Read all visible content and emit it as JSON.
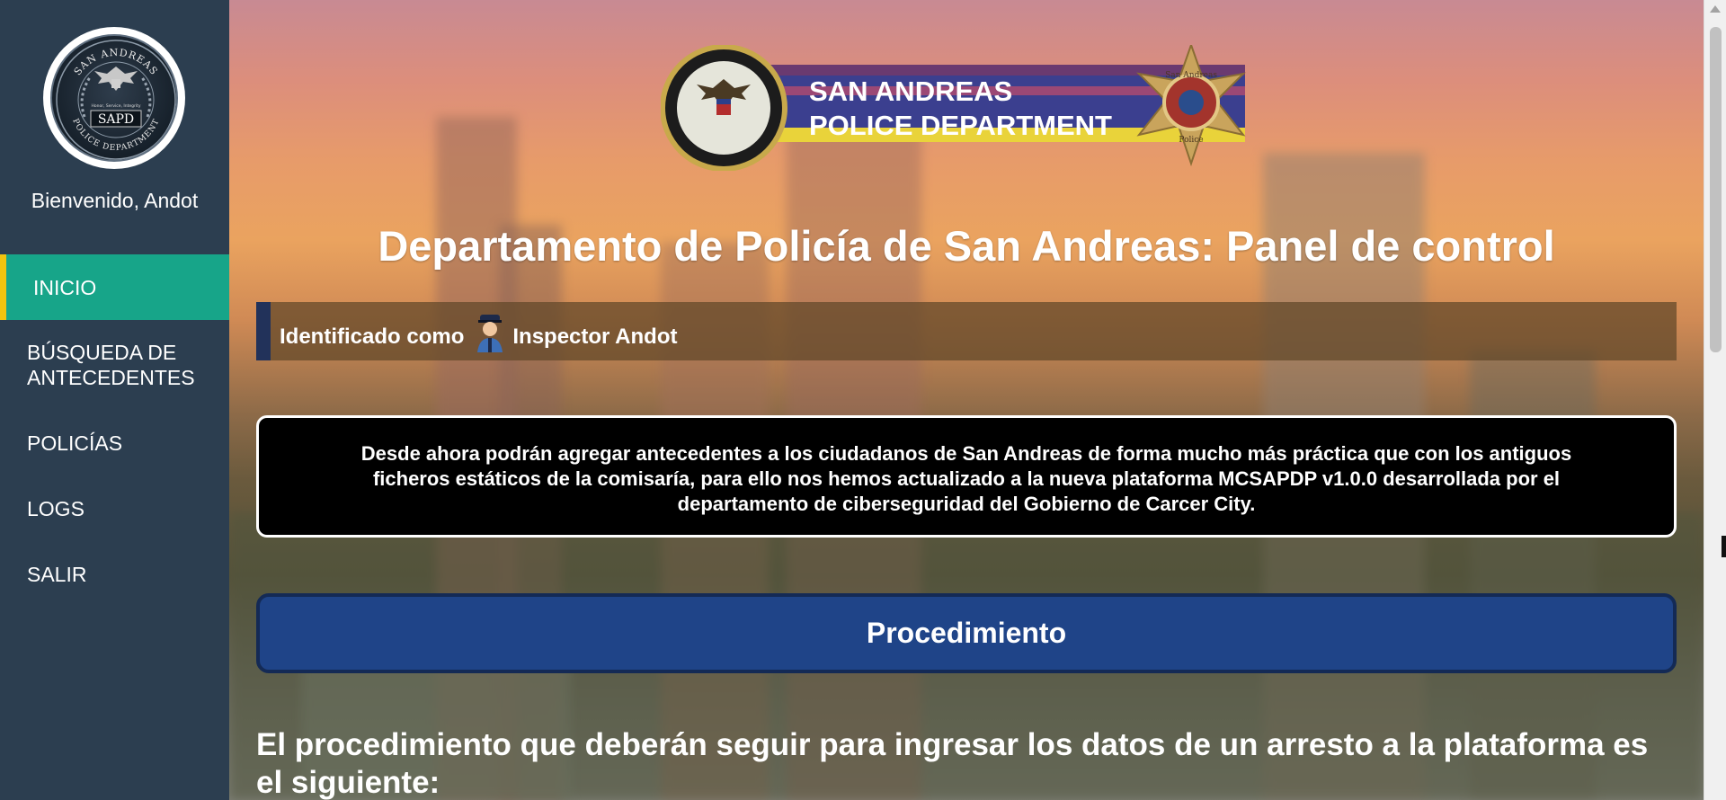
{
  "sidebar": {
    "logo": {
      "top_text": "SAN ANDREAS",
      "center_text": "SAPD",
      "motto": "Honor, Service, Integrity",
      "bottom_text": "POLICE DEPARTMENT"
    },
    "welcome": "Bienvenido, Andot",
    "nav": [
      {
        "label": "INICIO",
        "active": true
      },
      {
        "label": "BÚSQUEDA DE ANTECEDENTES",
        "line1": "BÚSQUEDA DE",
        "line2": "ANTECEDENTES"
      },
      {
        "label": "POLICÍAS"
      },
      {
        "label": "LOGS"
      },
      {
        "label": "SALIR"
      }
    ],
    "colors": {
      "background": "#2c3e50",
      "active": "#17a589",
      "active_edge": "#f1c40f"
    }
  },
  "banner": {
    "line1": "SAN ANDREAS",
    "line2": "POLICE DEPARTMENT",
    "badge_top": "San Andreas",
    "badge_bottom": "Police"
  },
  "page_title": "Departamento de Policía de San Andreas: Panel de control",
  "identity": {
    "prefix": "Identificado como",
    "icon": "police-officer-icon",
    "name": "Inspector Andot"
  },
  "notice": "Desde ahora podrán agregar antecedentes a los ciudadanos de San Andreas de forma mucho más práctica que con los antiguos ficheros estáticos de la comisaría, para ello nos hemos actualizado a la nueva plataforma MCSAPDP v1.0.0 desarrollada por el departamento de ciberseguridad del Gobierno de Carcer City.",
  "procedure_button": "Procedimiento",
  "procedure_text": "El procedimiento que deberán seguir para ingresar los datos de un arresto a la plataforma es el siguiente:"
}
